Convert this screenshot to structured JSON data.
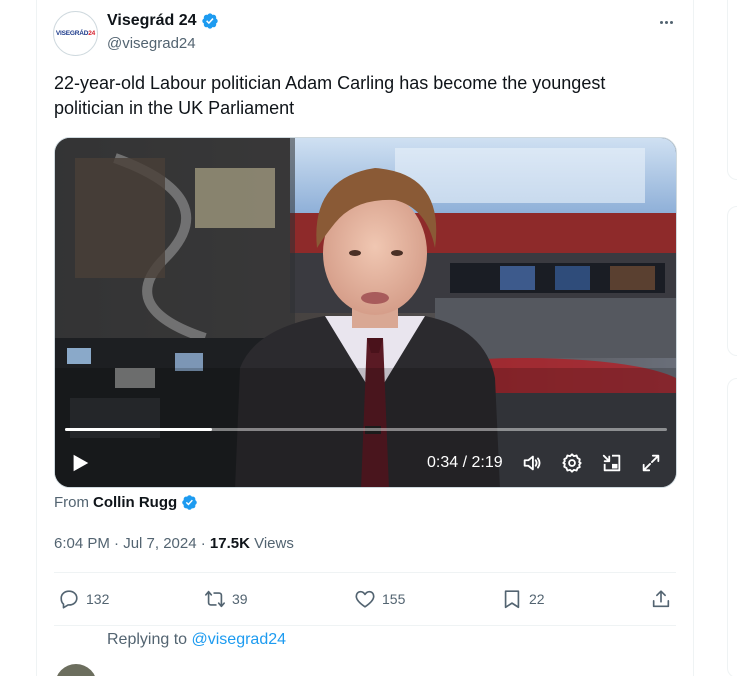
{
  "tweet": {
    "avatar_text_main": "VISEGRÁD",
    "avatar_text_accent": "24",
    "display_name": "Visegrád 24",
    "handle": "@visegrad24",
    "text": "22-year-old Labour politician Adam Carling has become the youngest politician in the UK Parliament",
    "from_label": "From",
    "from_name": "Collin Rugg",
    "timestamp": "6:04 PM · Jul 7, 2024 · ",
    "views_count": "17.5K",
    "views_label": " Views"
  },
  "video": {
    "time": "0:34 / 2:19",
    "progress_fraction": 0.245
  },
  "actions": {
    "replies": "132",
    "reposts": "39",
    "likes": "155",
    "bookmarks": "22"
  },
  "reply": {
    "prefix": "Replying to ",
    "handle": "@visegrad24"
  },
  "colors": {
    "accent": "#1d9bf0",
    "secondary_text": "#536471",
    "primary_text": "#0f1419"
  },
  "icons": [
    "verified-badge-icon",
    "more-icon",
    "play-icon",
    "volume-icon",
    "settings-icon",
    "pip-icon",
    "fullscreen-icon",
    "reply-icon",
    "repost-icon",
    "like-icon",
    "bookmark-icon",
    "share-icon"
  ]
}
